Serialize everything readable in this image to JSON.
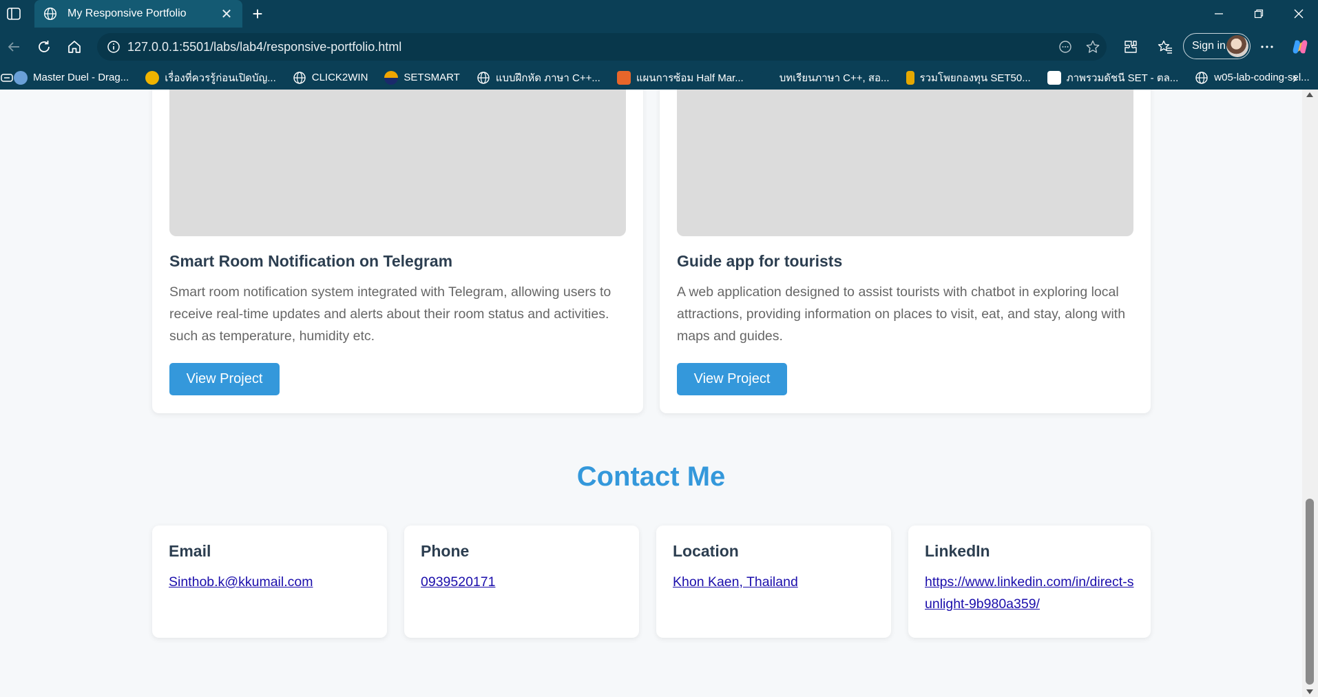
{
  "browser": {
    "tab_title": "My Responsive Portfolio",
    "url": "127.0.0.1:5501/labs/lab4/responsive-portfolio.html",
    "sign_in_label": "Sign in",
    "bookmarks": [
      "Master Duel - Drag...",
      "เรื่องที่ควรรู้ก่อนเปิดบัญ...",
      "CLICK2WIN",
      "SETSMART",
      "แบบฝึกหัด ภาษา C++...",
      "แผนการซ้อม Half Mar...",
      "บทเรียนภาษา C++, สอ...",
      "รวมโพยกองทุน SET50...",
      "ภาพรวมดัชนี SET - ตล...",
      "w05-lab-coding-sel..."
    ]
  },
  "projects": [
    {
      "title": "Smart Room Notification on Telegram",
      "description": "Smart room notification system integrated with Telegram, allowing users to receive real-time updates and alerts about their room status and activities. such as temperature, humidity etc.",
      "button_label": "View Project"
    },
    {
      "title": "Guide app for tourists",
      "description": "A web application designed to assist tourists with chatbot in exploring local attractions, providing information on places to visit, eat, and stay, along with maps and guides.",
      "button_label": "View Project"
    }
  ],
  "contact": {
    "heading": "Contact Me",
    "items": [
      {
        "label": "Email",
        "value": "Sinthob.k@kkumail.com"
      },
      {
        "label": "Phone",
        "value": "0939520171"
      },
      {
        "label": "Location",
        "value": "Khon Kaen, Thailand"
      },
      {
        "label": "LinkedIn",
        "value": "https://www.linkedin.com/in/direct-sunlight-9b980a359/"
      }
    ]
  },
  "colors": {
    "chrome": "#0b3f56",
    "accent": "#3498db",
    "heading_text": "#2c3e50",
    "body_text": "#666666",
    "link": "#1a0dab"
  }
}
